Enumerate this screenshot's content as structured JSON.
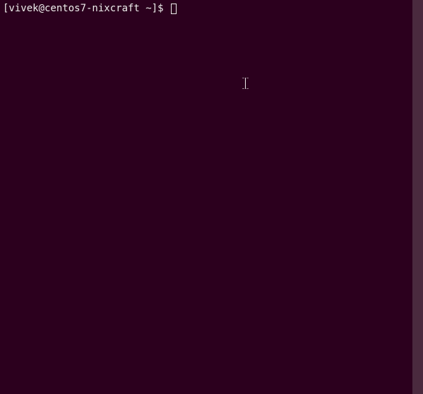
{
  "terminal": {
    "prompt": "[vivek@centos7-nixcraft ~]$ ",
    "command": ""
  }
}
